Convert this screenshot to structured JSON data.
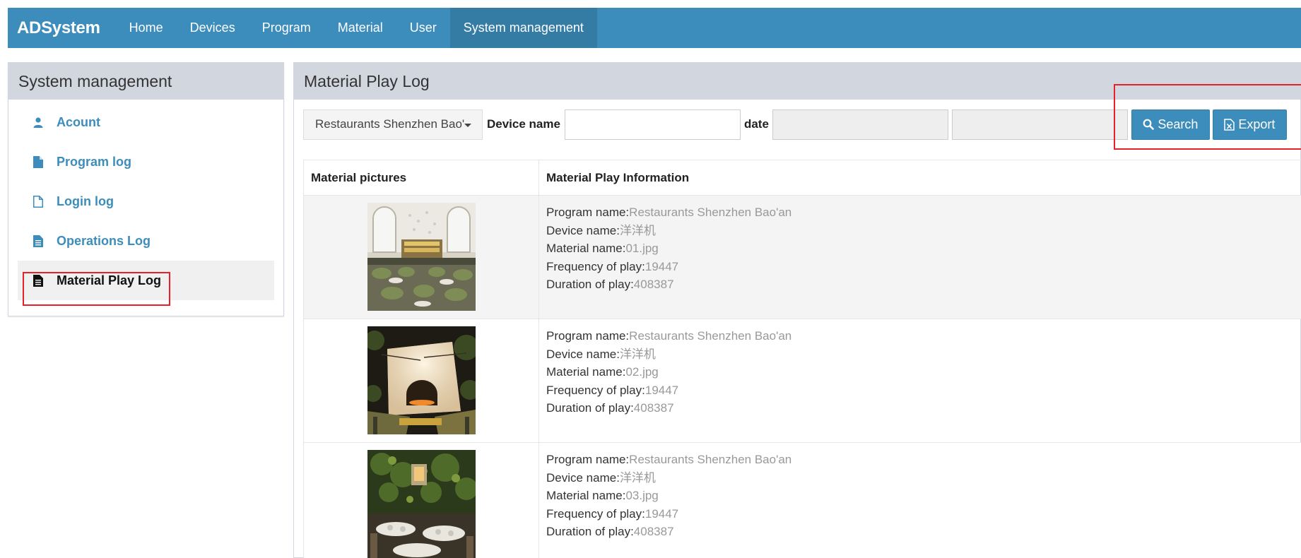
{
  "navbar": {
    "brand": "ADSystem",
    "items": [
      "Home",
      "Devices",
      "Program",
      "Material",
      "User",
      "System management"
    ],
    "active_index": 5,
    "color": "#3c8dbc"
  },
  "sidebar": {
    "title": "System management",
    "items": [
      {
        "label": "Acount",
        "icon": "user-icon"
      },
      {
        "label": "Program log",
        "icon": "file-icon"
      },
      {
        "label": "Login log",
        "icon": "file-outline-icon"
      },
      {
        "label": "Operations Log",
        "icon": "file-text-icon"
      },
      {
        "label": "Material Play Log",
        "icon": "file-text-icon",
        "active": true
      }
    ]
  },
  "main": {
    "title": "Material Play Log",
    "filter": {
      "program_select": "Restaurants Shenzhen Bao'an",
      "device_label": "Device name",
      "device_value": "",
      "date_label": "date",
      "date_start": "",
      "date_end": "",
      "search_label": "Search",
      "export_label": "Export"
    },
    "table": {
      "headers": [
        "Material pictures",
        "Material Play Information"
      ],
      "field_labels": {
        "program": "Program name:",
        "device": "Device name:",
        "material": "Material name:",
        "frequency": "Frequency of play:",
        "duration": "Duration of play:"
      },
      "rows": [
        {
          "program": "Restaurants Shenzhen Bao'an",
          "device": "洋洋机",
          "material": "01.jpg",
          "frequency": "19447",
          "duration": "408387"
        },
        {
          "program": "Restaurants Shenzhen Bao'an",
          "device": "洋洋机",
          "material": "02.jpg",
          "frequency": "19447",
          "duration": "408387"
        },
        {
          "program": "Restaurants Shenzhen Bao'an",
          "device": "洋洋机",
          "material": "03.jpg",
          "frequency": "19447",
          "duration": "408387"
        }
      ]
    }
  },
  "colors": {
    "accent": "#3c8dbc",
    "highlight": "#e8202a",
    "panel_header": "#d2d6de"
  }
}
